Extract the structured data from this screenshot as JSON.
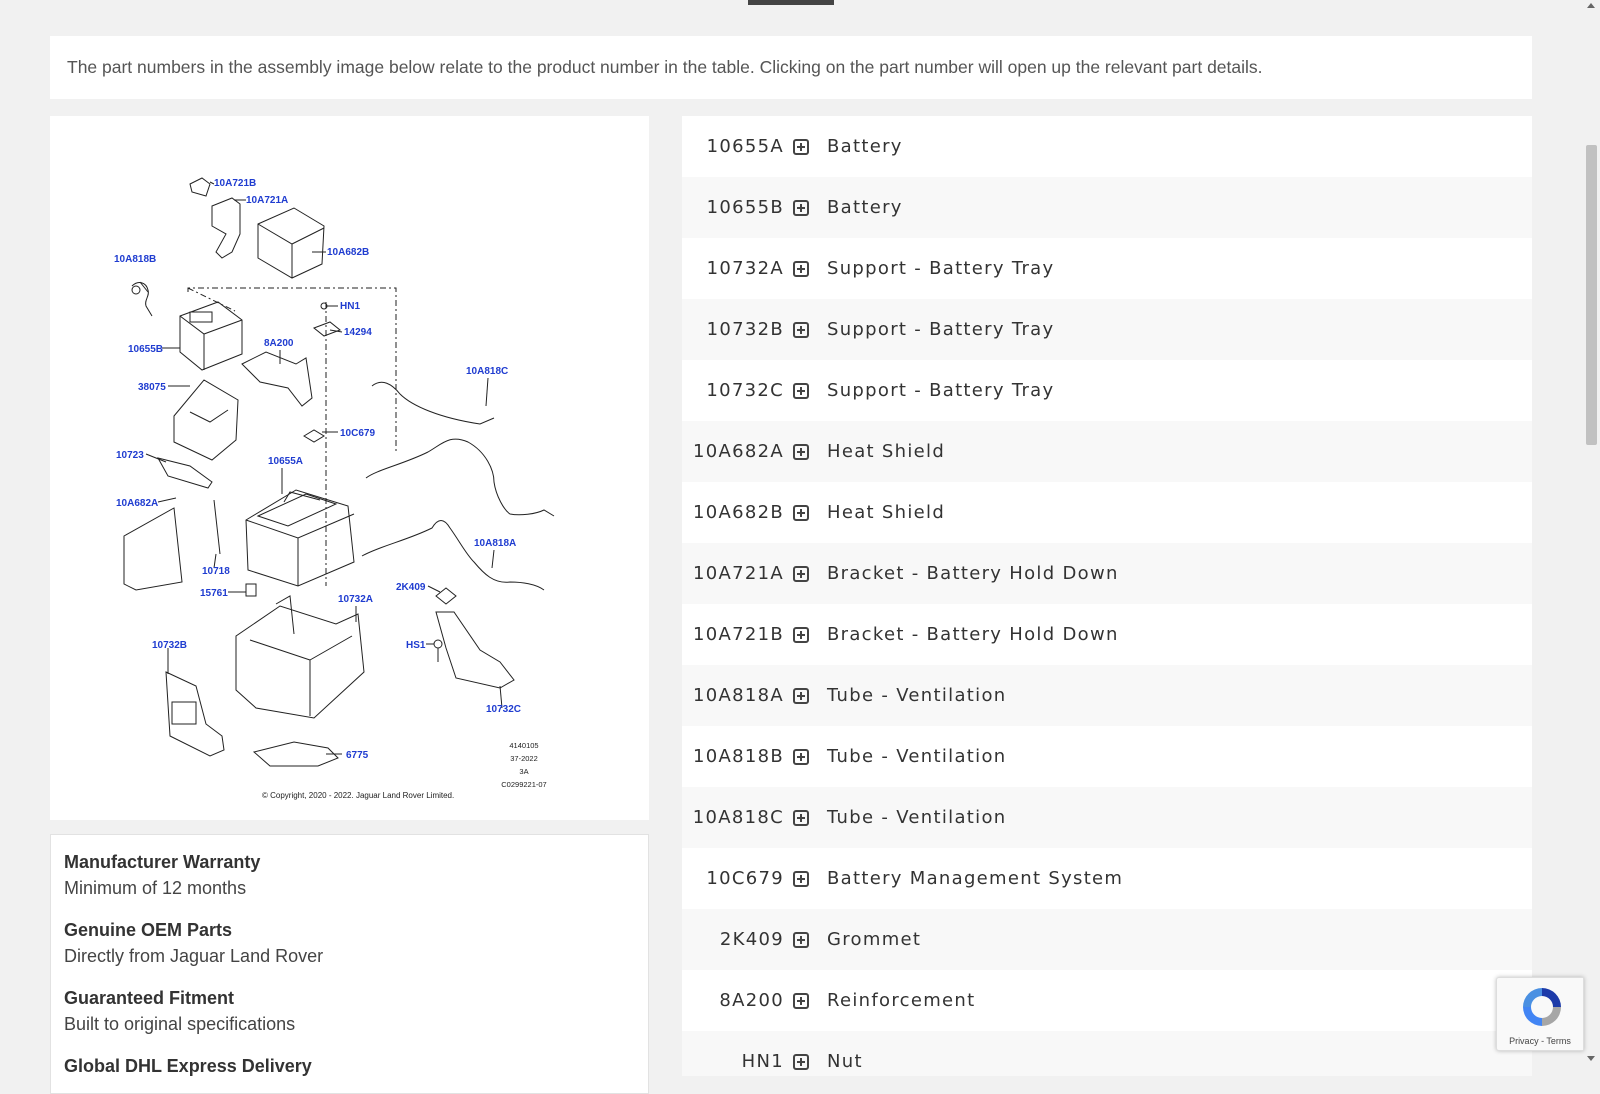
{
  "notice": {
    "text": "The part numbers in the assembly image below relate to the product number in the table. Clicking on the part number will open up the relevant part details."
  },
  "diagram": {
    "labels": {
      "l10A721B": "10A721B",
      "l10A721A": "10A721A",
      "l10A682B": "10A682B",
      "l10A818B": "10A818B",
      "lHN1": "HN1",
      "l14294": "14294",
      "l10655B": "10655B",
      "l8A200": "8A200",
      "l10A818C": "10A818C",
      "l38075": "38075",
      "l10C679": "10C679",
      "l10723": "10723",
      "l10655A": "10655A",
      "l10A682A": "10A682A",
      "l10A818A": "10A818A",
      "l10718": "10718",
      "l15761": "15761",
      "l2K409": "2K409",
      "l10732A": "10732A",
      "l10732B": "10732B",
      "lHS1": "HS1",
      "l10732C": "10732C",
      "l6775": "6775"
    },
    "code_lines": [
      "4140105",
      "37-2022",
      "3A",
      "C0299221-07"
    ],
    "copyright": "© Copyright, 2020 - 2022. Jaguar Land Rover Limited."
  },
  "info": {
    "items": [
      {
        "title": "Manufacturer Warranty",
        "desc": "Minimum of 12 months"
      },
      {
        "title": "Genuine OEM Parts",
        "desc": "Directly from Jaguar Land Rover"
      },
      {
        "title": "Guaranteed Fitment",
        "desc": "Built to original specifications"
      },
      {
        "title": "Global DHL Express Delivery",
        "desc": ""
      }
    ]
  },
  "parts": [
    {
      "number": "10655A",
      "name": "Battery"
    },
    {
      "number": "10655B",
      "name": "Battery"
    },
    {
      "number": "10732A",
      "name": "Support - Battery Tray"
    },
    {
      "number": "10732B",
      "name": "Support - Battery Tray"
    },
    {
      "number": "10732C",
      "name": "Support - Battery Tray"
    },
    {
      "number": "10A682A",
      "name": "Heat Shield"
    },
    {
      "number": "10A682B",
      "name": "Heat Shield"
    },
    {
      "number": "10A721A",
      "name": "Bracket - Battery Hold Down"
    },
    {
      "number": "10A721B",
      "name": "Bracket - Battery Hold Down"
    },
    {
      "number": "10A818A",
      "name": "Tube - Ventilation"
    },
    {
      "number": "10A818B",
      "name": "Tube - Ventilation"
    },
    {
      "number": "10A818C",
      "name": "Tube - Ventilation"
    },
    {
      "number": "10C679",
      "name": "Battery Management System"
    },
    {
      "number": "2K409",
      "name": "Grommet"
    },
    {
      "number": "8A200",
      "name": "Reinforcement"
    },
    {
      "number": "HN1",
      "name": "Nut"
    }
  ],
  "recaptcha": {
    "privacy": "Privacy",
    "separator": " - ",
    "terms": "Terms"
  },
  "icons": {
    "expand": "plus-square-icon",
    "recaptcha": "recaptcha-logo-icon"
  }
}
